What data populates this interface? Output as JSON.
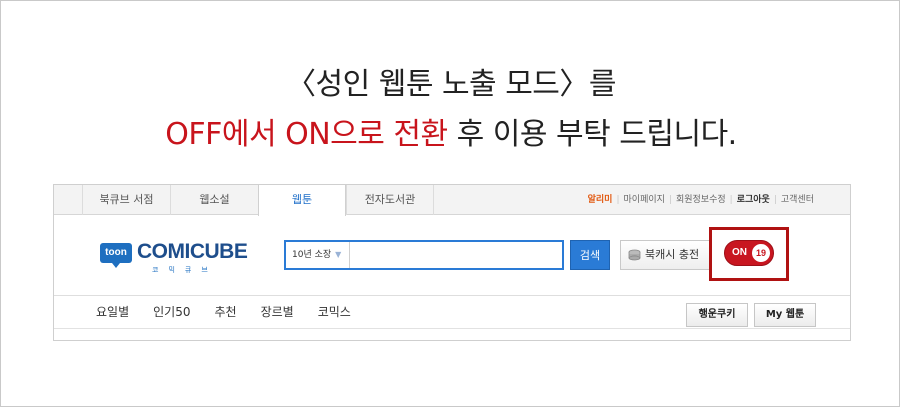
{
  "notice": {
    "line1": "〈성인 웹툰 노출 모드〉를",
    "line2_red": "OFF에서 ON으로 전환",
    "line2_rest": " 후 이용 부탁 드립니다."
  },
  "tabs": [
    "북큐브 서점",
    "웹소설",
    "웹툰",
    "전자도서관"
  ],
  "active_tab_index": 2,
  "util_links": {
    "alert": "알리미",
    "mypage": "마이페이지",
    "member_edit": "회원정보수정",
    "logout": "로그아웃",
    "support": "고객센터"
  },
  "logo": {
    "badge": "toon",
    "word": "COMICUBE",
    "sub": "코믹큐브"
  },
  "search": {
    "category": "10년 소장",
    "value": "",
    "button": "검색"
  },
  "charge_button": "북캐시 충전",
  "adult_toggle": {
    "state": "ON",
    "age": "19"
  },
  "menu_items": [
    "요일별",
    "인기50",
    "추천",
    "장르별",
    "코믹스"
  ],
  "right_buttons": {
    "lucky": "행운쿠키",
    "my": "My 웹툰"
  },
  "colors": {
    "accent_blue": "#2a7bd6",
    "notice_red": "#c8141c",
    "toggle_red": "#c81620"
  }
}
